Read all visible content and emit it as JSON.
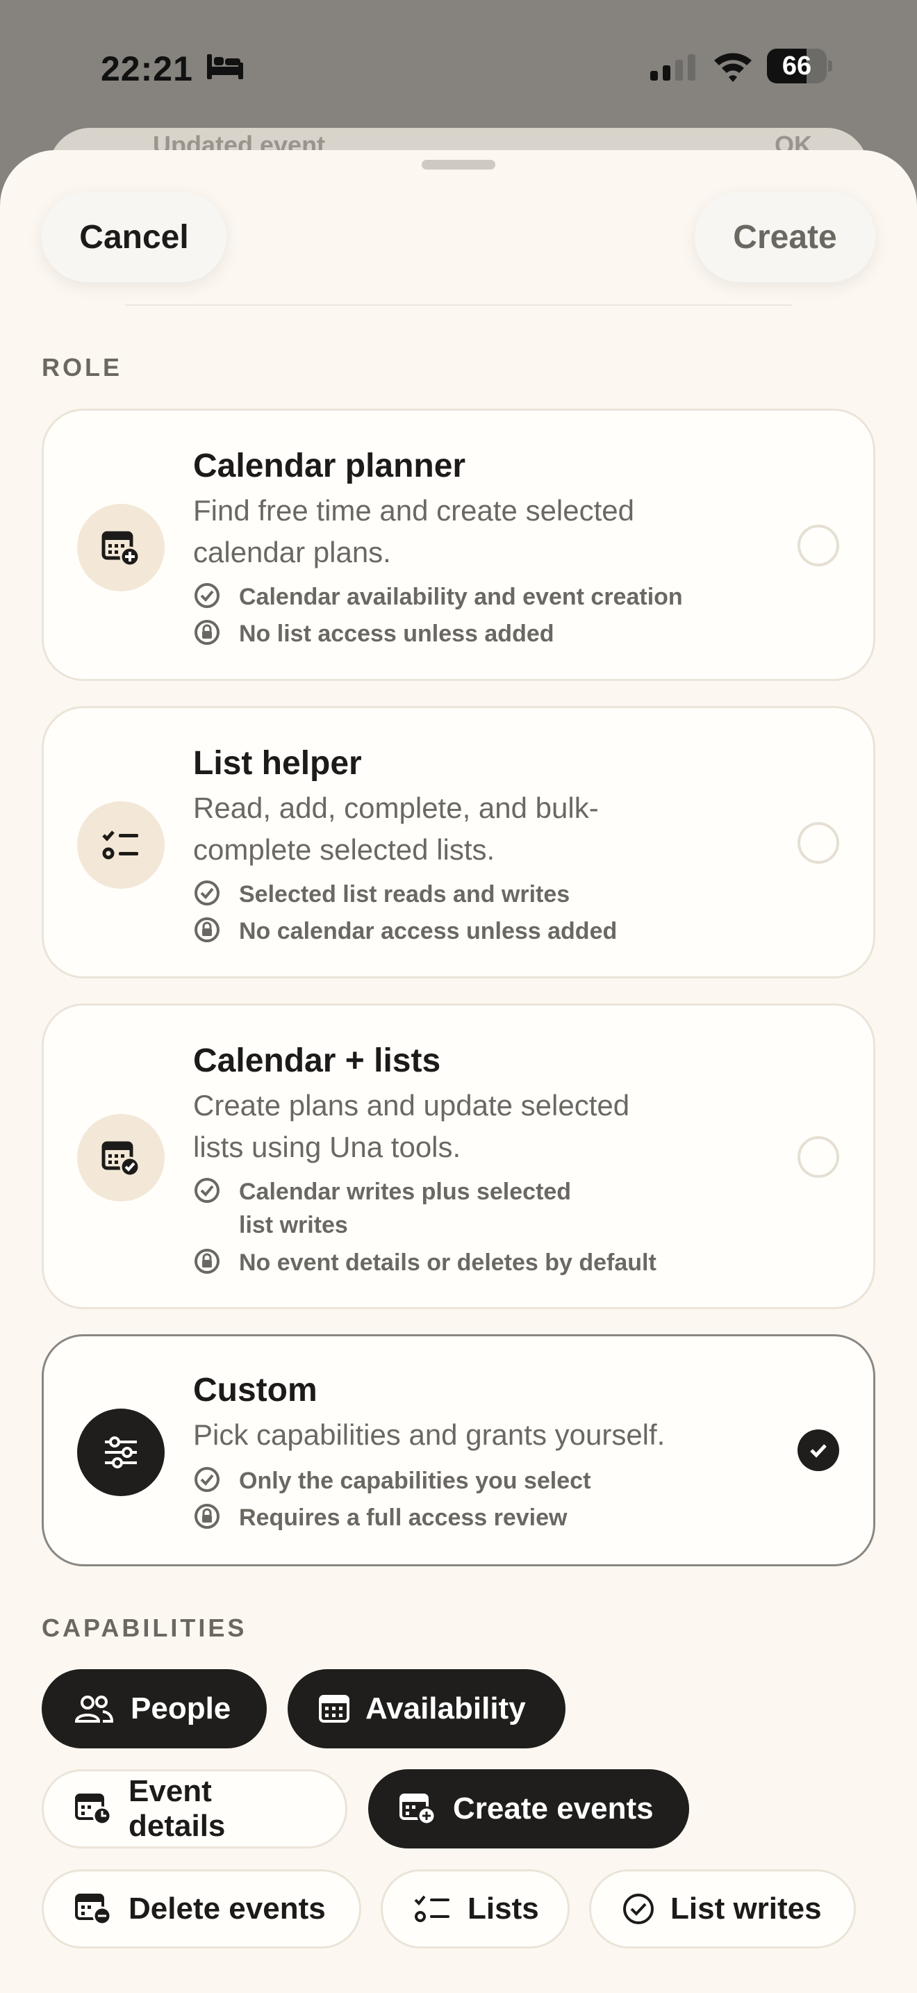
{
  "status_bar": {
    "time": "22:21",
    "battery": "66",
    "battery_level": 0.66
  },
  "behind_sheet": {
    "title": "Updated event",
    "ok": "OK"
  },
  "nav": {
    "cancel_label": "Cancel",
    "create_label": "Create"
  },
  "role_section": {
    "label": "ROLE",
    "roles": [
      {
        "title": "Calendar planner",
        "desc_line1": "Find free time and create selected",
        "desc_line2": "calendar plans.",
        "point1": "Calendar availability and event creation",
        "point2": "No list access unless added",
        "icon": "calendar-plus-icon",
        "selected": false
      },
      {
        "title": "List helper",
        "desc_line1": "Read, add, complete, and bulk-",
        "desc_line2": "complete selected lists.",
        "point1": "Selected list reads and writes",
        "point2": "No calendar access unless added",
        "icon": "list-icon",
        "selected": false
      },
      {
        "title": "Calendar + lists",
        "desc_line1": "Create plans and update selected",
        "desc_line2": "lists using Una tools.",
        "point1_line1": "Calendar writes plus selected",
        "point1_line2": "list writes",
        "point2": "No event details or deletes by default",
        "icon": "calendar-check-icon",
        "selected": false
      },
      {
        "title": "Custom",
        "desc_line1": "Pick capabilities and grants yourself.",
        "point1": "Only the capabilities you select",
        "point2": "Requires a full access review",
        "icon": "sliders-icon",
        "selected": true
      }
    ]
  },
  "capabilities_section": {
    "label": "CAPABILITIES",
    "chips": [
      {
        "label": "People",
        "icon": "people-icon",
        "selected": true
      },
      {
        "label": "Availability",
        "icon": "calendar-icon",
        "selected": true
      },
      {
        "label": "Event details",
        "icon": "calendar-clock-icon",
        "selected": false
      },
      {
        "label": "Create events",
        "icon": "calendar-plus-icon",
        "selected": true
      },
      {
        "label": "Delete events",
        "icon": "calendar-minus-icon",
        "selected": false
      },
      {
        "label": "Lists",
        "icon": "list-icon",
        "selected": false
      },
      {
        "label": "List writes",
        "icon": "check-circle-icon",
        "selected": false
      }
    ]
  },
  "colors": {
    "sheet_background": "#fcf8f1",
    "accent_dark": "#1f1e1c",
    "icon_badge": "#f3e8d7",
    "muted_text": "#6b6862"
  }
}
